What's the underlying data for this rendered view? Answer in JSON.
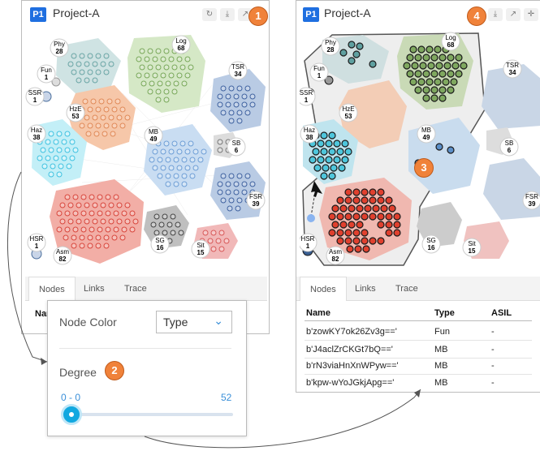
{
  "left_panel": {
    "badge": "P1",
    "title": "Project-A",
    "callout": "1",
    "tools": [
      "refresh-icon",
      "download-icon",
      "expand-icon"
    ],
    "tabs": [
      "Nodes",
      "Links",
      "Trace"
    ],
    "table_header_partial": "Nar"
  },
  "right_panel": {
    "badge": "P1",
    "title": "Project-A",
    "callout": "4",
    "graph_callout": "3",
    "tools": [
      "download-icon",
      "expand-icon",
      "move-icon"
    ],
    "tabs": [
      "Nodes",
      "Links",
      "Trace"
    ],
    "table": {
      "headers": [
        "Name",
        "Type",
        "ASIL"
      ],
      "rows": [
        [
          "b'zowKY7ok26Zv3g=='",
          "Fun",
          "-"
        ],
        [
          "b'J4aclZrCKGt7bQ=='",
          "MB",
          "-"
        ],
        [
          "b'rN3viaHnXnWPyw=='",
          "MB",
          "-"
        ],
        [
          "b'kpw-wYoJGkjApg=='",
          "MB",
          "-"
        ]
      ]
    }
  },
  "popup": {
    "node_color_label": "Node Color",
    "node_color_value": "Type",
    "degree_label": "Degree",
    "callout": "2",
    "range_text": "0 - 0",
    "max_value": "52",
    "slider_level": 0
  },
  "clusters": [
    {
      "label": "Phy",
      "count": "28",
      "color": "#8fc2c2"
    },
    {
      "label": "Log",
      "count": "68",
      "color": "#9dc67e"
    },
    {
      "label": "Fun",
      "count": "1",
      "color": "#999999"
    },
    {
      "label": "SSR",
      "count": "1",
      "color": "#4a6e9c"
    },
    {
      "label": "TSR",
      "count": "34",
      "color": "#4f74b0"
    },
    {
      "label": "HzE",
      "count": "53",
      "color": "#ee9a68"
    },
    {
      "label": "Haz",
      "count": "38",
      "color": "#6fd6ea"
    },
    {
      "label": "MB",
      "count": "49",
      "color": "#7eaadb"
    },
    {
      "label": "SB",
      "count": "6",
      "color": "#999999"
    },
    {
      "label": "FSR",
      "count": "39",
      "color": "#4f74b0"
    },
    {
      "label": "Asm",
      "count": "82",
      "color": "#ea5a4e"
    },
    {
      "label": "SG",
      "count": "16",
      "color": "#777777"
    },
    {
      "label": "Sit",
      "count": "15",
      "color": "#e98080"
    },
    {
      "label": "HSR",
      "count": "1",
      "color": "#4a6e9c"
    }
  ]
}
